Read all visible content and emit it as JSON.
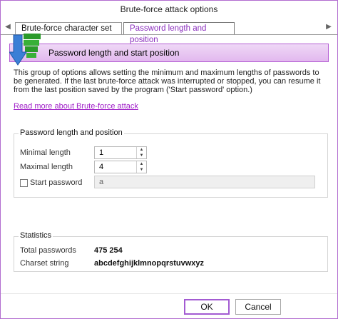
{
  "window": {
    "title": "Brute-force attack options"
  },
  "tabs": [
    {
      "label": "Brute-force character set",
      "active": false
    },
    {
      "label": "Password length and position",
      "active": true
    }
  ],
  "banner": {
    "title": "Password length and start position"
  },
  "description": "This group of options allows setting the minimum and maximum lengths of passwords to be generated. If the last brute-force attack was interrupted or stopped, you can resume it from the last position saved by the program ('Start password' option.)",
  "read_more_link": "Read more about Brute-force attack",
  "length_group": {
    "title": "Password length and position",
    "minimal_label": "Minimal length",
    "minimal_value": "1",
    "maximal_label": "Maximal length",
    "maximal_value": "4",
    "start_label": "Start password",
    "start_checked": false,
    "start_value": "a"
  },
  "stats_group": {
    "title": "Statistics",
    "total_label": "Total passwords",
    "total_value": "475 254",
    "charset_label": "Charset string",
    "charset_value": "abcdefghijklmnopqrstuvwxyz"
  },
  "buttons": {
    "ok": "OK",
    "cancel": "Cancel"
  },
  "colors": {
    "accent": "#a35bd2",
    "banner": "#e2b8ee",
    "link": "#a020c8"
  }
}
